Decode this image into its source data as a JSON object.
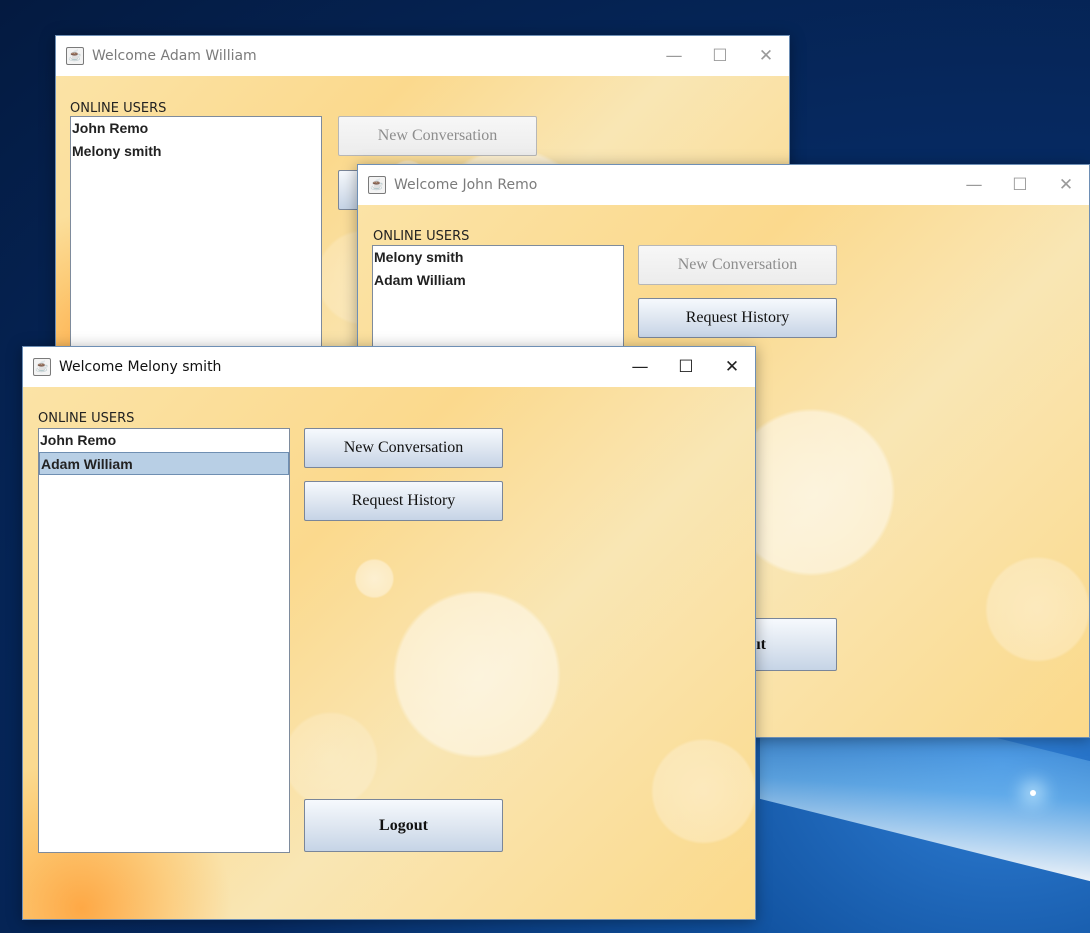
{
  "windows": {
    "adam": {
      "title": "Welcome Adam William",
      "online_label": "ONLINE USERS",
      "users": [
        "John Remo",
        "Melony smith"
      ],
      "new_conversation": "New Conversation"
    },
    "john": {
      "title": "Welcome John Remo",
      "online_label": "ONLINE USERS",
      "users": [
        "Melony smith",
        "Adam William"
      ],
      "new_conversation": "New Conversation",
      "request_history": "Request History",
      "logout_partial": "ıt"
    },
    "melony": {
      "title": "Welcome Melony smith",
      "online_label": "ONLINE USERS",
      "users": [
        "John Remo",
        "Adam William"
      ],
      "selected_user": "Adam William",
      "new_conversation": "New Conversation",
      "request_history": "Request History",
      "logout": "Logout"
    }
  },
  "controls": {
    "minimize": "—",
    "maximize": "☐",
    "close": "✕"
  },
  "icons": {
    "app": "java-cup-icon"
  }
}
